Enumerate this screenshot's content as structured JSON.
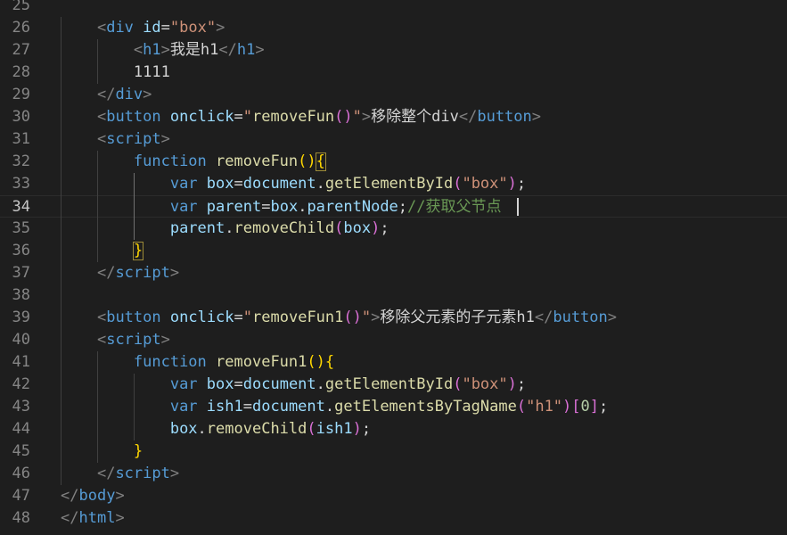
{
  "editor": {
    "language": "html",
    "current_line": 34,
    "colors": {
      "background": "#1e1e1e",
      "line_number": "#858585",
      "tag_bracket": "#808080",
      "tag_name": "#569cd6",
      "attribute": "#9cdcfe",
      "string": "#ce9178",
      "function": "#dcdcaa",
      "comment": "#6a9955",
      "bracket_gold": "#ffd700",
      "bracket_purple": "#da70d6"
    },
    "lines": [
      {
        "n": "25",
        "tokens": []
      },
      {
        "n": "26",
        "tokens": [
          [
            "    ",
            "txt"
          ],
          [
            "<",
            "tag"
          ],
          [
            "div",
            "el"
          ],
          [
            " ",
            "txt"
          ],
          [
            "id",
            "attr"
          ],
          [
            "=",
            "txt"
          ],
          [
            "\"box\"",
            "str"
          ],
          [
            ">",
            "tag"
          ]
        ]
      },
      {
        "n": "27",
        "tokens": [
          [
            "        ",
            "txt"
          ],
          [
            "<",
            "tag"
          ],
          [
            "h1",
            "el"
          ],
          [
            ">",
            "tag"
          ],
          [
            "我是h1",
            "txt"
          ],
          [
            "</",
            "tag"
          ],
          [
            "h1",
            "el"
          ],
          [
            ">",
            "tag"
          ]
        ]
      },
      {
        "n": "28",
        "tokens": [
          [
            "        ",
            "txt"
          ],
          [
            "1111",
            "txt"
          ]
        ]
      },
      {
        "n": "29",
        "tokens": [
          [
            "    ",
            "txt"
          ],
          [
            "</",
            "tag"
          ],
          [
            "div",
            "el"
          ],
          [
            ">",
            "tag"
          ]
        ]
      },
      {
        "n": "30",
        "tokens": [
          [
            "    ",
            "txt"
          ],
          [
            "<",
            "tag"
          ],
          [
            "button",
            "el"
          ],
          [
            " ",
            "txt"
          ],
          [
            "onclick",
            "attr"
          ],
          [
            "=",
            "txt"
          ],
          [
            "\"",
            "str"
          ],
          [
            "removeFun",
            "fn"
          ],
          [
            "()",
            "b2"
          ],
          [
            "\"",
            "str"
          ],
          [
            ">",
            "tag"
          ],
          [
            "移除整个div",
            "txt"
          ],
          [
            "</",
            "tag"
          ],
          [
            "button",
            "el"
          ],
          [
            ">",
            "tag"
          ]
        ]
      },
      {
        "n": "31",
        "tokens": [
          [
            "    ",
            "txt"
          ],
          [
            "<",
            "tag"
          ],
          [
            "script",
            "el"
          ],
          [
            ">",
            "tag"
          ]
        ]
      },
      {
        "n": "32",
        "tokens": [
          [
            "        ",
            "txt"
          ],
          [
            "function",
            "kw"
          ],
          [
            " ",
            "txt"
          ],
          [
            "removeFun",
            "fn"
          ],
          [
            "()",
            "b1"
          ],
          [
            "{",
            "b1"
          ]
        ]
      },
      {
        "n": "33",
        "tokens": [
          [
            "            ",
            "txt"
          ],
          [
            "var",
            "kw"
          ],
          [
            " ",
            "txt"
          ],
          [
            "box",
            "var"
          ],
          [
            "=",
            "txt"
          ],
          [
            "document",
            "var"
          ],
          [
            ".",
            "txt"
          ],
          [
            "getElementById",
            "fn"
          ],
          [
            "(",
            "b2"
          ],
          [
            "\"box\"",
            "str"
          ],
          [
            ")",
            "b2"
          ],
          [
            ";",
            "txt"
          ]
        ]
      },
      {
        "n": "34",
        "tokens": [
          [
            "            ",
            "txt"
          ],
          [
            "var",
            "kw"
          ],
          [
            " ",
            "txt"
          ],
          [
            "parent",
            "var"
          ],
          [
            "=",
            "txt"
          ],
          [
            "box",
            "var"
          ],
          [
            ".",
            "txt"
          ],
          [
            "parentNode",
            "var"
          ],
          [
            ";",
            "txt"
          ],
          [
            "//获取父节点",
            "cmt"
          ]
        ]
      },
      {
        "n": "35",
        "tokens": [
          [
            "            ",
            "txt"
          ],
          [
            "parent",
            "var"
          ],
          [
            ".",
            "txt"
          ],
          [
            "removeChild",
            "fn"
          ],
          [
            "(",
            "b2"
          ],
          [
            "box",
            "var"
          ],
          [
            ")",
            "b2"
          ],
          [
            ";",
            "txt"
          ]
        ]
      },
      {
        "n": "36",
        "tokens": [
          [
            "        ",
            "txt"
          ],
          [
            "}",
            "b1"
          ]
        ]
      },
      {
        "n": "37",
        "tokens": [
          [
            "    ",
            "txt"
          ],
          [
            "</",
            "tag"
          ],
          [
            "script",
            "el"
          ],
          [
            ">",
            "tag"
          ]
        ]
      },
      {
        "n": "38",
        "tokens": []
      },
      {
        "n": "39",
        "tokens": [
          [
            "    ",
            "txt"
          ],
          [
            "<",
            "tag"
          ],
          [
            "button",
            "el"
          ],
          [
            " ",
            "txt"
          ],
          [
            "onclick",
            "attr"
          ],
          [
            "=",
            "txt"
          ],
          [
            "\"",
            "str"
          ],
          [
            "removeFun1",
            "fn"
          ],
          [
            "()",
            "b2"
          ],
          [
            "\"",
            "str"
          ],
          [
            ">",
            "tag"
          ],
          [
            "移除父元素的子元素h1",
            "txt"
          ],
          [
            "</",
            "tag"
          ],
          [
            "button",
            "el"
          ],
          [
            ">",
            "tag"
          ]
        ]
      },
      {
        "n": "40",
        "tokens": [
          [
            "    ",
            "txt"
          ],
          [
            "<",
            "tag"
          ],
          [
            "script",
            "el"
          ],
          [
            ">",
            "tag"
          ]
        ]
      },
      {
        "n": "41",
        "tokens": [
          [
            "        ",
            "txt"
          ],
          [
            "function",
            "kw"
          ],
          [
            " ",
            "txt"
          ],
          [
            "removeFun1",
            "fn"
          ],
          [
            "()",
            "b1"
          ],
          [
            "{",
            "b1"
          ]
        ]
      },
      {
        "n": "42",
        "tokens": [
          [
            "            ",
            "txt"
          ],
          [
            "var",
            "kw"
          ],
          [
            " ",
            "txt"
          ],
          [
            "box",
            "var"
          ],
          [
            "=",
            "txt"
          ],
          [
            "document",
            "var"
          ],
          [
            ".",
            "txt"
          ],
          [
            "getElementById",
            "fn"
          ],
          [
            "(",
            "b2"
          ],
          [
            "\"box\"",
            "str"
          ],
          [
            ")",
            "b2"
          ],
          [
            ";",
            "txt"
          ]
        ]
      },
      {
        "n": "43",
        "tokens": [
          [
            "            ",
            "txt"
          ],
          [
            "var",
            "kw"
          ],
          [
            " ",
            "txt"
          ],
          [
            "ish1",
            "var"
          ],
          [
            "=",
            "txt"
          ],
          [
            "document",
            "var"
          ],
          [
            ".",
            "txt"
          ],
          [
            "getElementsByTagName",
            "fn"
          ],
          [
            "(",
            "b2"
          ],
          [
            "\"h1\"",
            "str"
          ],
          [
            ")",
            "b2"
          ],
          [
            "[",
            "b2"
          ],
          [
            "0",
            "num"
          ],
          [
            "]",
            "b2"
          ],
          [
            ";",
            "txt"
          ]
        ]
      },
      {
        "n": "44",
        "tokens": [
          [
            "            ",
            "txt"
          ],
          [
            "box",
            "var"
          ],
          [
            ".",
            "txt"
          ],
          [
            "removeChild",
            "fn"
          ],
          [
            "(",
            "b2"
          ],
          [
            "ish1",
            "var"
          ],
          [
            ")",
            "b2"
          ],
          [
            ";",
            "txt"
          ]
        ]
      },
      {
        "n": "45",
        "tokens": [
          [
            "        ",
            "txt"
          ],
          [
            "}",
            "b1"
          ]
        ]
      },
      {
        "n": "46",
        "tokens": [
          [
            "    ",
            "txt"
          ],
          [
            "</",
            "tag"
          ],
          [
            "script",
            "el"
          ],
          [
            ">",
            "tag"
          ]
        ]
      },
      {
        "n": "47",
        "tokens": [
          [
            "",
            "txt"
          ],
          [
            "</",
            "tag"
          ],
          [
            "body",
            "el"
          ],
          [
            ">",
            "tag"
          ]
        ]
      },
      {
        "n": "48",
        "tokens": [
          [
            "",
            "txt"
          ],
          [
            "</",
            "tag"
          ],
          [
            "html",
            "el"
          ],
          [
            ">",
            "tag"
          ]
        ]
      }
    ]
  }
}
